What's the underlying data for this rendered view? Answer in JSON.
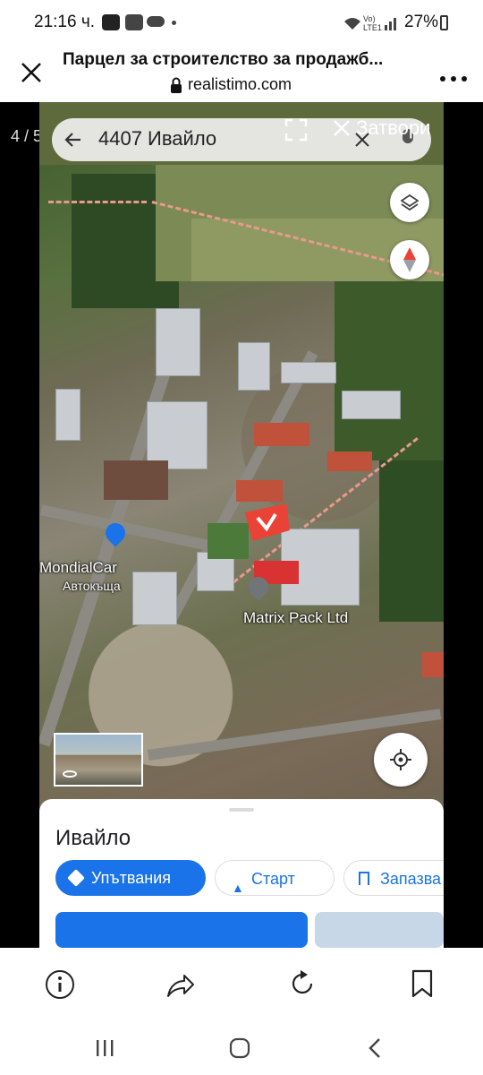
{
  "status_bar": {
    "time": "21:16 ч.",
    "battery": "27%",
    "network": "Vo) LTE1"
  },
  "header": {
    "title": "Парцел за строителство за продажб...",
    "url": "realistimo.com"
  },
  "viewer": {
    "pager": "4 / 5",
    "close_label": "Затвори",
    "search_query": "4407 Ивайло",
    "map_labels": {
      "mondial_name": "MondialCar",
      "mondial_sub": "Автокъща",
      "matrix": "Matrix Pack Ltd"
    },
    "sheet": {
      "place": "Ивайло",
      "directions": "Упътвания",
      "start": "Старт",
      "save": "Запазва"
    }
  },
  "colors": {
    "accent_blue": "#1a73e8",
    "marker_red": "#ea4335",
    "boundary_pink": "#e89a8c"
  }
}
